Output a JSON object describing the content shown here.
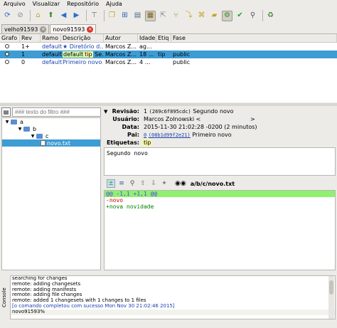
{
  "menu": [
    "Arquivo",
    "Visualizar",
    "Repositório",
    "Ajuda"
  ],
  "tabs": [
    {
      "label": "velho91593",
      "close": "×"
    },
    {
      "label": "novo91593",
      "close": "×"
    }
  ],
  "graph": {
    "headers": [
      "Grafo",
      "Rev",
      "Ramo",
      "Descrição",
      "Autor",
      "Idade",
      "Etiq",
      "Fase"
    ],
    "rows": [
      {
        "rev": "1+",
        "branch": "default",
        "desc": "★ Diretório d...",
        "author": "Marcos Z...",
        "age": "ag...",
        "tag": "",
        "phase": ""
      },
      {
        "rev": "1",
        "branch": "default",
        "branch_pill": "default",
        "tag_pill": "tip",
        "desc": "Se...",
        "author": "Marcos Z...",
        "age": "18 ...",
        "tag": "tip",
        "phase": "public"
      },
      {
        "rev": "0",
        "branch": "default",
        "desc": "Primeiro novo",
        "author": "Marcos Z...",
        "age": "4 ...",
        "tag": "",
        "phase": "public"
      }
    ]
  },
  "filter": {
    "placeholder": "### texto do filtro ###"
  },
  "tree": [
    {
      "label": "a",
      "type": "folder",
      "depth": 0
    },
    {
      "label": "b",
      "type": "folder",
      "depth": 1
    },
    {
      "label": "c",
      "type": "folder",
      "depth": 2
    },
    {
      "label": "novo.txt",
      "type": "file",
      "depth": 3
    }
  ],
  "revision": {
    "labels": {
      "rev": "Revisão:",
      "user": "Usuário:",
      "date": "Data:",
      "parent": "Pai:",
      "tags": "Etiquetas:"
    },
    "rev_num": "1",
    "rev_hash": "(269c6f895cdc)",
    "rev_desc": "Segundo novo",
    "user": "Marcos Zolnowski <",
    "user_end": ">",
    "date": "2015-11-30 21:02:28 -0200 (2 minutos)",
    "parent_num": "0",
    "parent_hash": "(08b1d99f2e21)",
    "parent_desc": "Primeiro novo",
    "tag": "tip"
  },
  "description": "Segundo novo",
  "diff": {
    "path": "a/b/c/novo.txt",
    "lines": [
      {
        "kind": "hunk",
        "text": "@@ -1,1 +1,1 @@"
      },
      {
        "kind": "del",
        "text": "-novo"
      },
      {
        "kind": "add",
        "text": "+nova novidade"
      }
    ]
  },
  "console": {
    "label": "Console",
    "lines": [
      {
        "kind": "out",
        "text": "searching for changes"
      },
      {
        "kind": "out",
        "text": "remote: adding changesets"
      },
      {
        "kind": "out",
        "text": "remote: adding manifests"
      },
      {
        "kind": "out",
        "text": "remote: adding file changes"
      },
      {
        "kind": "out",
        "text": "remote: added 1 changesets with 1 changes to 1 files"
      },
      {
        "kind": "ok",
        "text": "[o comando completou com sucesso Mon Nov 30 21:02:46 2015]"
      },
      {
        "kind": "input",
        "text": "novo91593%"
      }
    ]
  },
  "colors": {
    "selection": "#3d9cd4",
    "branch_pill": "#d5f5a8",
    "tag_pill": "#f7f7a0",
    "hunk": "#90f070",
    "deleted": "#d00000",
    "added": "#008000"
  }
}
